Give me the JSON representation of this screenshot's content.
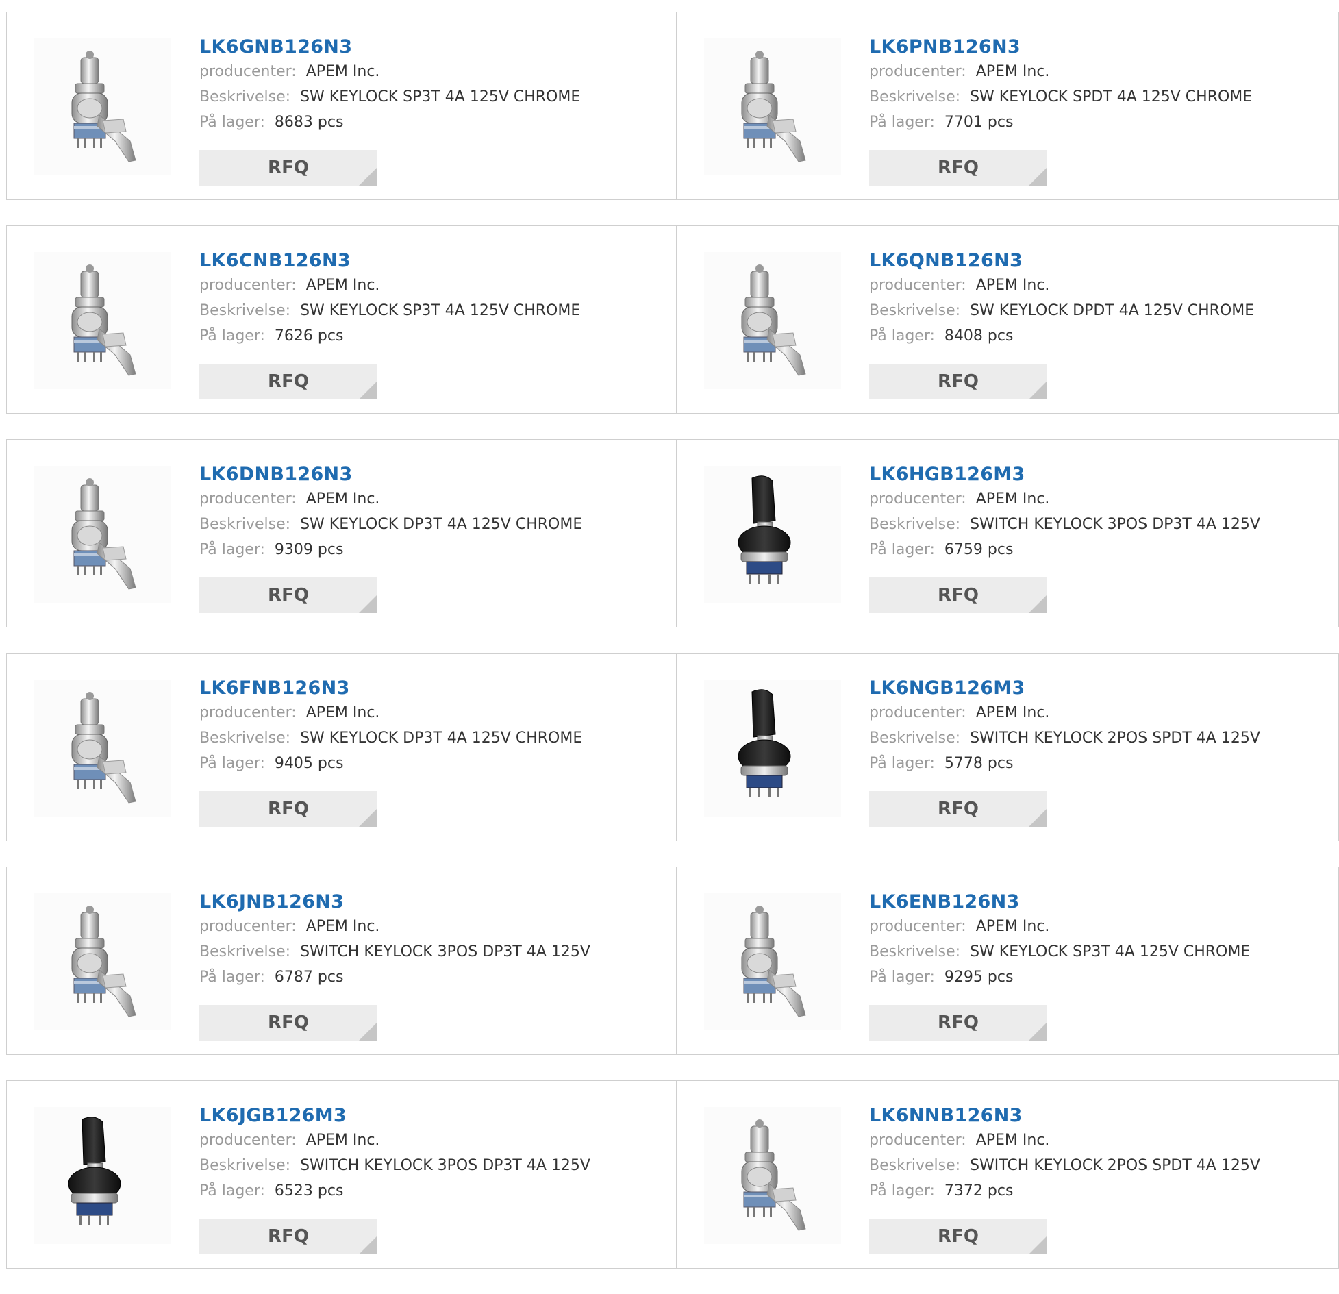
{
  "labels": {
    "manufacturer": "producenter:",
    "description": "Beskrivelse:",
    "stock": "På lager:",
    "rfq": "RFQ"
  },
  "colors": {
    "link": "#1f6bb0",
    "label": "#9a9a9a",
    "value": "#333333",
    "button_bg": "#ececec",
    "border": "#cfcfcf"
  },
  "products": [
    {
      "part": "LK6GNB126N3",
      "manufacturer": "APEM Inc.",
      "description": "SW KEYLOCK SP3T 4A 125V CHROME",
      "stock": "8683 pcs",
      "image": "chrome-keylock-image"
    },
    {
      "part": "LK6PNB126N3",
      "manufacturer": "APEM Inc.",
      "description": "SW KEYLOCK SPDT 4A 125V CHROME",
      "stock": "7701 pcs",
      "image": "chrome-keylock-image"
    },
    {
      "part": "LK6CNB126N3",
      "manufacturer": "APEM Inc.",
      "description": "SW KEYLOCK SP3T 4A 125V CHROME",
      "stock": "7626 pcs",
      "image": "chrome-keylock-image"
    },
    {
      "part": "LK6QNB126N3",
      "manufacturer": "APEM Inc.",
      "description": "SW KEYLOCK DPDT 4A 125V CHROME",
      "stock": "8408 pcs",
      "image": "chrome-keylock-image"
    },
    {
      "part": "LK6DNB126N3",
      "manufacturer": "APEM Inc.",
      "description": "SW KEYLOCK DP3T 4A 125V CHROME",
      "stock": "9309 pcs",
      "image": "chrome-keylock-image"
    },
    {
      "part": "LK6HGB126M3",
      "manufacturer": "APEM Inc.",
      "description": "SWITCH KEYLOCK 3POS DP3T 4A 125V",
      "stock": "6759 pcs",
      "image": "black-keylock-image"
    },
    {
      "part": "LK6FNB126N3",
      "manufacturer": "APEM Inc.",
      "description": "SW KEYLOCK DP3T 4A 125V CHROME",
      "stock": "9405 pcs",
      "image": "chrome-keylock-image"
    },
    {
      "part": "LK6NGB126M3",
      "manufacturer": "APEM Inc.",
      "description": "SWITCH KEYLOCK 2POS SPDT 4A 125V",
      "stock": "5778 pcs",
      "image": "black-keylock-image"
    },
    {
      "part": "LK6JNB126N3",
      "manufacturer": "APEM Inc.",
      "description": "SWITCH KEYLOCK 3POS DP3T 4A 125V",
      "stock": "6787 pcs",
      "image": "chrome-keylock-image"
    },
    {
      "part": "LK6ENB126N3",
      "manufacturer": "APEM Inc.",
      "description": "SW KEYLOCK SP3T 4A 125V CHROME",
      "stock": "9295 pcs",
      "image": "chrome-keylock-image"
    },
    {
      "part": "LK6JGB126M3",
      "manufacturer": "APEM Inc.",
      "description": "SWITCH KEYLOCK 3POS DP3T 4A 125V",
      "stock": "6523 pcs",
      "image": "black-keylock-image"
    },
    {
      "part": "LK6NNB126N3",
      "manufacturer": "APEM Inc.",
      "description": "SWITCH KEYLOCK 2POS SPDT 4A 125V",
      "stock": "7372 pcs",
      "image": "chrome-keylock-image"
    }
  ]
}
